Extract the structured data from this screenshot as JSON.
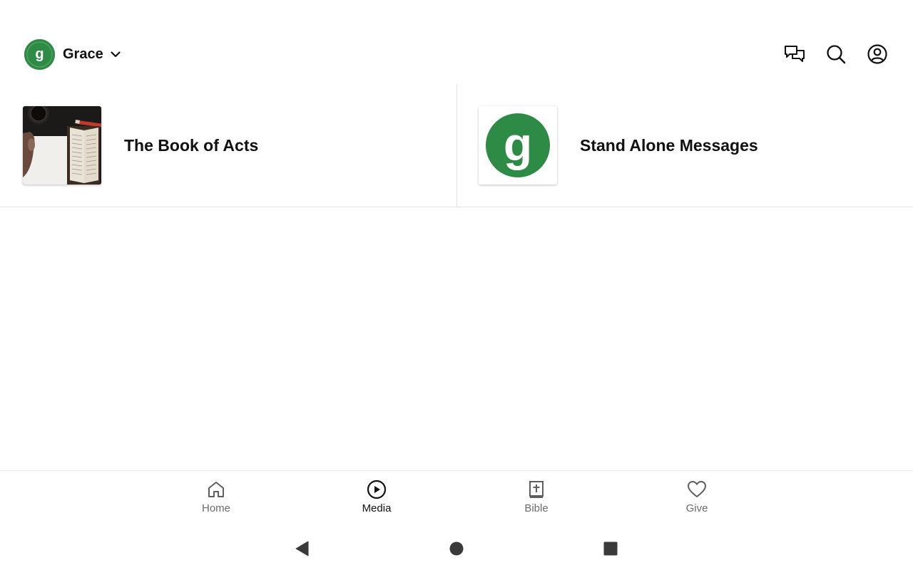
{
  "header": {
    "org_name": "Grace",
    "logo_letter": "g",
    "brand_color": "#2e8b45",
    "icons": [
      "messages-icon",
      "search-icon",
      "account-icon"
    ]
  },
  "media": {
    "items": [
      {
        "title": "The Book of Acts",
        "thumbnail": "open-bible-photo"
      },
      {
        "title": "Stand Alone Messages",
        "thumbnail": "church-logo",
        "logo_letter": "g"
      }
    ]
  },
  "bottom_nav": {
    "active": "Media",
    "items": [
      {
        "label": "Home",
        "icon": "home-icon"
      },
      {
        "label": "Media",
        "icon": "play-circle-icon"
      },
      {
        "label": "Bible",
        "icon": "bible-icon"
      },
      {
        "label": "Give",
        "icon": "heart-icon"
      }
    ]
  },
  "system_nav": {
    "buttons": [
      "back-icon",
      "home-circle-icon",
      "recents-icon"
    ]
  }
}
